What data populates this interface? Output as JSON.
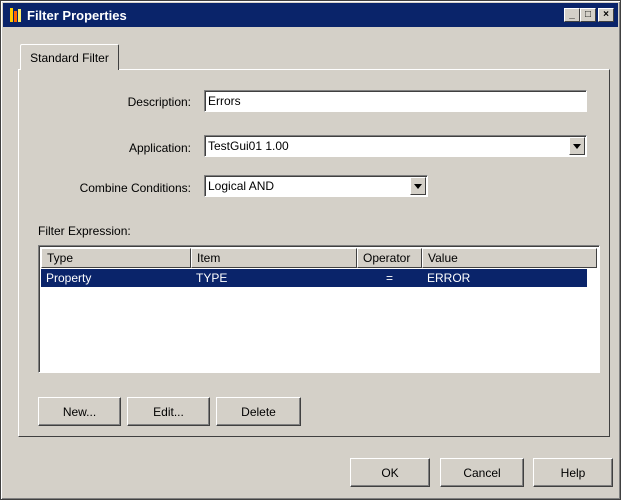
{
  "window": {
    "title": "Filter Properties",
    "controls": {
      "minimize": "_",
      "maximize": "□",
      "close": "×"
    }
  },
  "tabs": [
    {
      "label": "Standard Filter"
    }
  ],
  "form": {
    "description": {
      "label": "Description:",
      "value": "Errors"
    },
    "application": {
      "label": "Application:",
      "value": "TestGui01 1.00"
    },
    "combine": {
      "label": "Combine Conditions:",
      "value": "Logical AND"
    },
    "expression_label": "Filter Expression:"
  },
  "expression": {
    "columns": [
      "Type",
      "Item",
      "Operator",
      "Value"
    ],
    "rows": [
      {
        "type": "Property",
        "item": "TYPE",
        "operator": "=",
        "value": "ERROR",
        "selected": true
      }
    ]
  },
  "buttons": {
    "new": "New...",
    "edit": "Edit...",
    "delete": "Delete",
    "ok": "OK",
    "cancel": "Cancel",
    "help": "Help"
  },
  "colors": {
    "titlebar": "#0a246a",
    "face": "#d4d0c8",
    "selection": "#0a246a"
  }
}
